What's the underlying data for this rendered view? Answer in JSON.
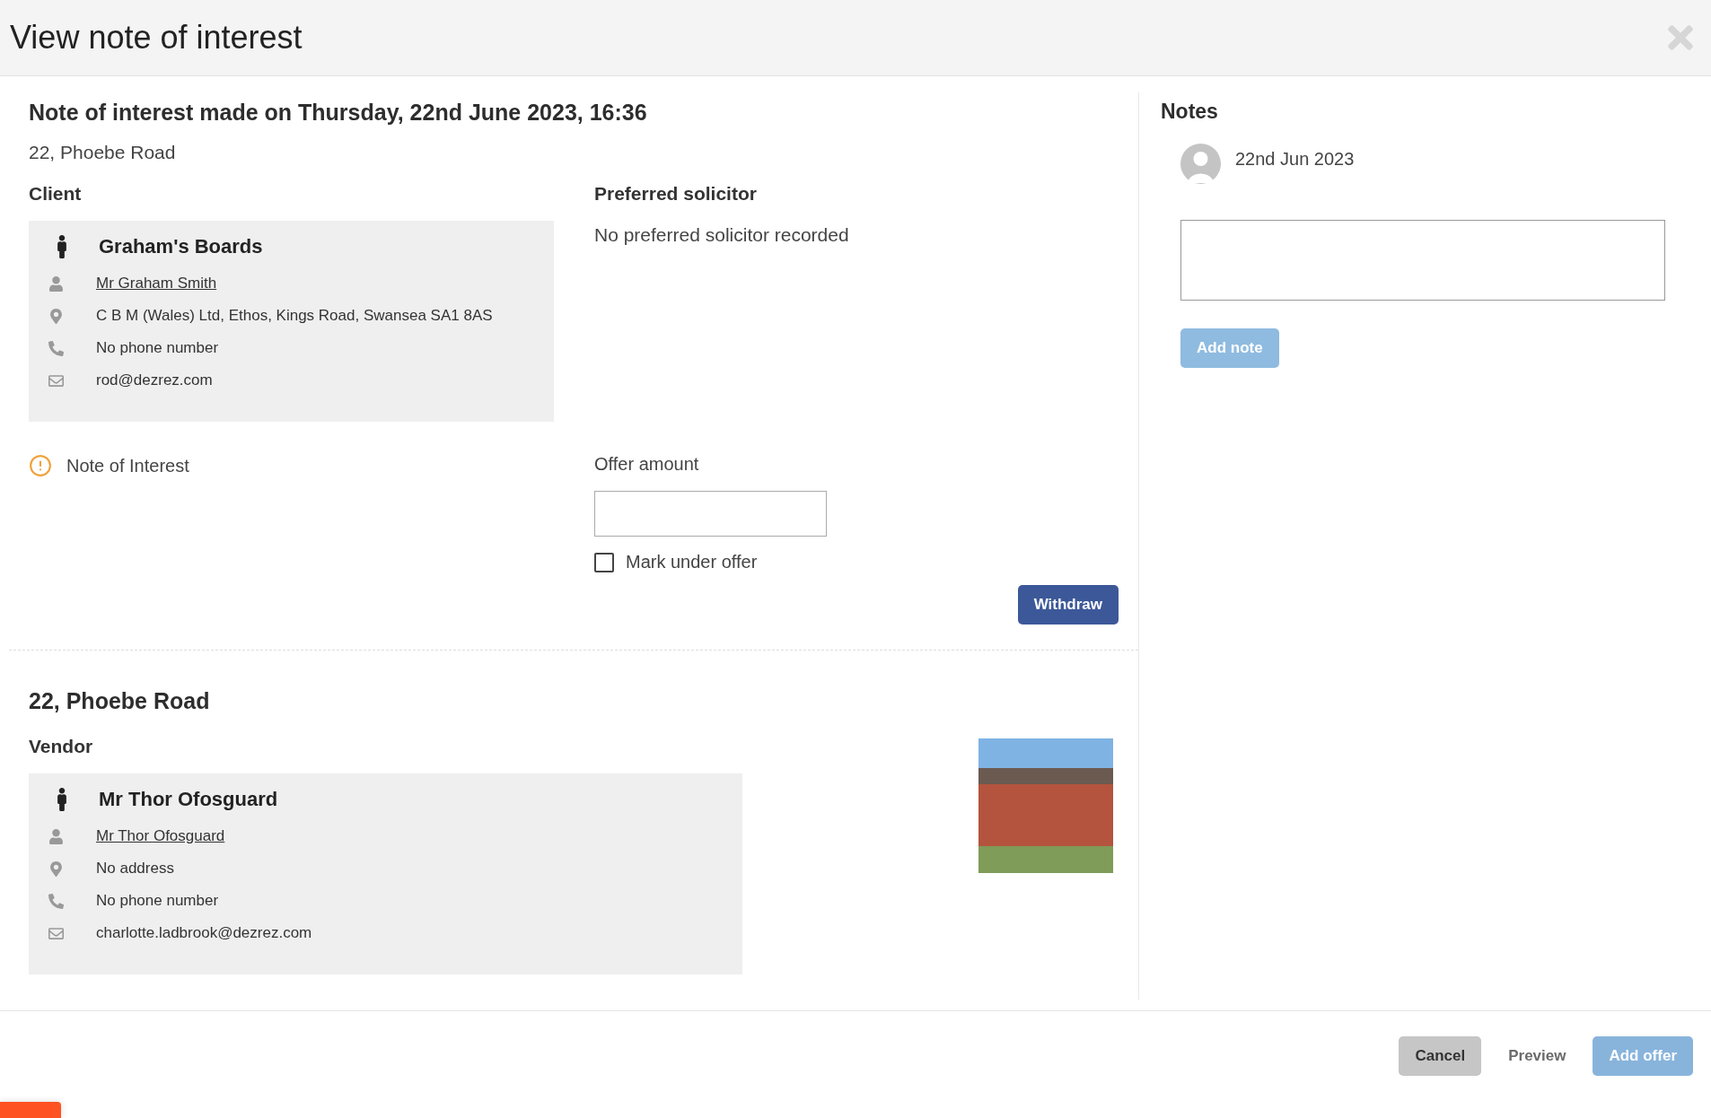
{
  "dialog": {
    "title": "View note of interest"
  },
  "note": {
    "heading": "Note of interest made on Thursday, 22nd June 2023, 16:36",
    "address": "22, Phoebe Road",
    "client": {
      "label": "Client",
      "name": "Graham's Boards",
      "details": [
        {
          "kind": "person",
          "text": "Mr Graham Smith",
          "link": true
        },
        {
          "kind": "address",
          "text": "C B M (Wales) Ltd, Ethos, Kings Road, Swansea SA1 8AS",
          "link": false
        },
        {
          "kind": "phone",
          "text": "No phone number",
          "link": false
        },
        {
          "kind": "email",
          "text": "rod@dezrez.com",
          "link": false
        }
      ]
    },
    "solicitor": {
      "label": "Preferred solicitor",
      "text": "No preferred solicitor recorded"
    },
    "status": {
      "label": "Note of Interest"
    },
    "offer": {
      "label": "Offer amount",
      "mark_under_offer": {
        "label": "Mark under offer",
        "checked": false
      }
    },
    "withdraw_button": "Withdraw"
  },
  "property": {
    "title": "22, Phoebe Road",
    "vendor": {
      "label": "Vendor",
      "name": "Mr Thor Ofosguard",
      "details": [
        {
          "kind": "person",
          "text": "Mr Thor Ofosguard",
          "link": true
        },
        {
          "kind": "address",
          "text": "No address",
          "link": false
        },
        {
          "kind": "phone",
          "text": "No phone number",
          "link": false
        },
        {
          "kind": "email",
          "text": "charlotte.ladbrook@dezrez.com",
          "link": false
        }
      ]
    }
  },
  "notes": {
    "title": "Notes",
    "entries": [
      {
        "date": "22nd Jun 2023"
      }
    ],
    "add_button": {
      "label": "Add note",
      "disabled": true
    }
  },
  "footer": {
    "buttons": [
      {
        "label": "Cancel",
        "kind": "secondary",
        "disabled": false
      },
      {
        "label": "Preview",
        "kind": "link",
        "disabled": false
      },
      {
        "label": "Add offer",
        "kind": "primary",
        "disabled": true
      }
    ]
  }
}
